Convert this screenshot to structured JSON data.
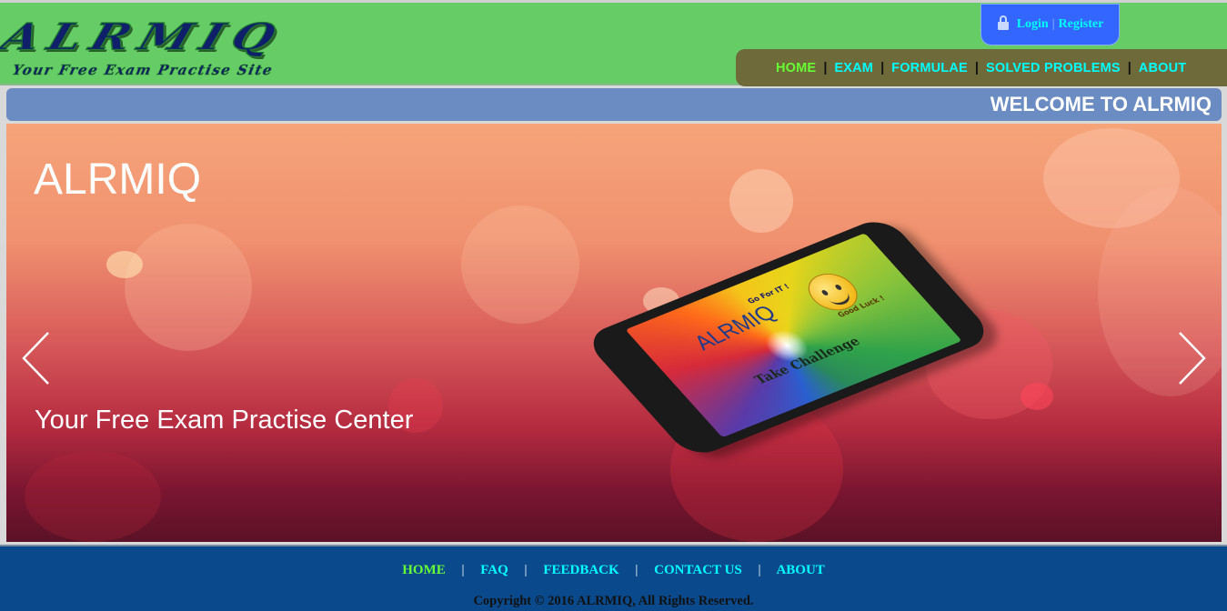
{
  "header": {
    "logo_title": "ALRMIQ",
    "logo_subtitle": "Your Free Exam Practise Site",
    "login": {
      "login_label": "Login",
      "separator": "|",
      "register_label": "Register",
      "icon": "lock-icon"
    },
    "nav": [
      {
        "label": "HOME",
        "active": true
      },
      {
        "label": "EXAM",
        "active": false
      },
      {
        "label": "FORMULAE",
        "active": false
      },
      {
        "label": "SOLVED PROBLEMS",
        "active": false
      },
      {
        "label": "ABOUT",
        "active": false
      }
    ],
    "nav_separator": "|"
  },
  "welcome_text": "WELCOME TO ALRMIQ",
  "hero": {
    "title": "ALRMIQ",
    "subtitle": "Your Free Exam Practise Center",
    "prev_icon": "chevron-left-icon",
    "next_icon": "chevron-right-icon",
    "phone": {
      "brand": "ALRMIQ",
      "tagline": "Take Challenge",
      "badge_top": "Go For IT !",
      "badge_bottom": "Good Luck !"
    }
  },
  "footer": {
    "nav": [
      {
        "label": "HOME",
        "active": true
      },
      {
        "label": "FAQ",
        "active": false
      },
      {
        "label": "FEEDBACK",
        "active": false
      },
      {
        "label": "CONTACT US",
        "active": false
      },
      {
        "label": "ABOUT",
        "active": false
      }
    ],
    "nav_separator": "|",
    "copyright": "Copyright © 2016 ALRMIQ, All Rights Reserved."
  },
  "colors": {
    "header_bg": "#66cc66",
    "nav_bg": "#6e6a3a",
    "link": "#00ffff",
    "active_link": "#66ff33",
    "welcome_bg": "#6b8cc2",
    "footer_bg": "#0a4a8c",
    "login_bg": "#3366ff"
  }
}
